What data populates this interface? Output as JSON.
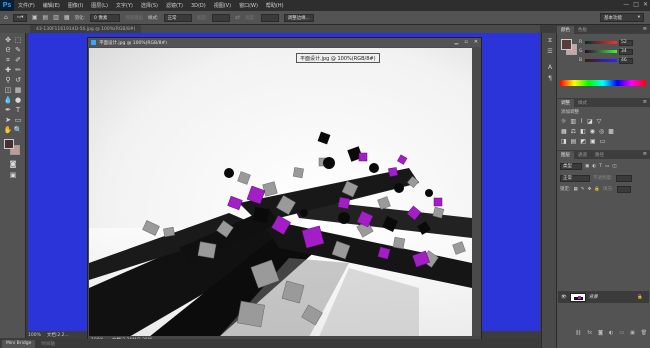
{
  "app": {
    "logo": "Ps"
  },
  "menu": [
    "文件(F)",
    "编辑(E)",
    "图像(I)",
    "图层(L)",
    "文字(Y)",
    "选择(S)",
    "滤镜(T)",
    "3D(D)",
    "视图(V)",
    "窗口(W)",
    "帮助(H)"
  ],
  "window_controls": {
    "minimize": "—",
    "maximize": "□",
    "close": "✕"
  },
  "options_bar": {
    "feather_label": "羽化:",
    "feather_value": "0 像素",
    "antialias_label": "消除锯齿",
    "style_label": "样式:",
    "style_value": "正常",
    "width_label": "宽度:",
    "height_label": "高度:",
    "refine_button": "调整边缘...",
    "workspace": "基本功能"
  },
  "doc_tab": {
    "label": "43-130F1161914D-56.jpg @ 100%(RGB/8#)"
  },
  "document": {
    "title": "平面设计.jpg @ 100%(RGB/8#)",
    "zoom": "100%",
    "doc_info": "文档:2.25M/2.25M"
  },
  "tooltip": "平面设计.jpg @ 100%(RGB/8#)",
  "main_status": {
    "zoom": "100%",
    "doc_info": "文档:2.2..."
  },
  "bottom_tabs": [
    {
      "label": "Mini Bridge",
      "active": true
    },
    {
      "label": "时间轴",
      "active": false
    }
  ],
  "color_panel": {
    "tabs": [
      {
        "label": "颜色",
        "active": true
      },
      {
        "label": "色板",
        "active": false
      }
    ],
    "r_label": "R",
    "r_value": "52",
    "g_label": "G",
    "g_value": "34",
    "b_label": "B",
    "b_value": "46",
    "fg_color": "#5a3c3c",
    "bg_color": "#c2a8a6"
  },
  "adjust_panel": {
    "tabs": [
      {
        "label": "调整",
        "active": true
      },
      {
        "label": "样式",
        "active": false
      }
    ],
    "title": "添加调整"
  },
  "layers_panel": {
    "tabs": [
      {
        "label": "图层",
        "active": true
      },
      {
        "label": "通道",
        "active": false
      },
      {
        "label": "路径",
        "active": false
      }
    ],
    "kind_label": "类型",
    "blend_mode": "正常",
    "opacity_label": "不透明度:",
    "lock_label": "锁定:",
    "fill_label": "填充:",
    "layer_name": "背景"
  },
  "colors": {
    "canvas_bg": "#2a34d9",
    "cube_purple": "#a41ec8",
    "panel_bg": "#535353"
  }
}
